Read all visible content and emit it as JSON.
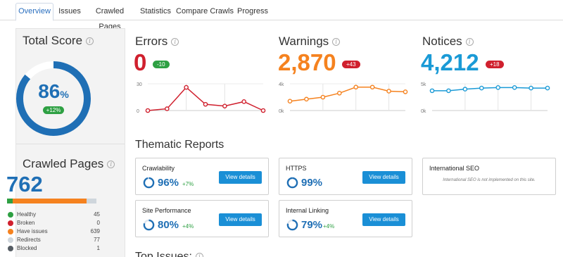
{
  "tabs": [
    "Overview",
    "Issues",
    "Crawled Pages",
    "Statistics",
    "Compare Crawls",
    "Progress"
  ],
  "total_score": {
    "title": "Total Score",
    "value": "86",
    "unit": "%",
    "delta": "+12%",
    "fraction": 0.86
  },
  "crawled_pages": {
    "title": "Crawled Pages",
    "value": "762",
    "legend": [
      {
        "label": "Healthy",
        "count": "45",
        "color": "#2ea043"
      },
      {
        "label": "Broken",
        "count": "0",
        "color": "#d0202e"
      },
      {
        "label": "Have issues",
        "count": "639",
        "color": "#f5821f"
      },
      {
        "label": "Redirects",
        "count": "77",
        "color": "#cfd6dc"
      },
      {
        "label": "Blocked",
        "count": "1",
        "color": "#555c63"
      }
    ]
  },
  "metrics": {
    "errors": {
      "title": "Errors",
      "value": "0",
      "delta": "-10",
      "color": "#d0202e",
      "badge_color": "#2ea043"
    },
    "warnings": {
      "title": "Warnings",
      "value": "2,870",
      "delta": "+43",
      "color": "#f5821f",
      "badge_color": "#d0202e"
    },
    "notices": {
      "title": "Notices",
      "value": "4,212",
      "delta": "+18",
      "color": "#1a9ad6",
      "badge_color": "#d0202e"
    }
  },
  "chart_data": [
    {
      "type": "line",
      "series": [
        {
          "values": [
            0,
            2,
            26,
            7,
            5,
            10,
            0
          ]
        }
      ],
      "ylim": [
        0,
        30
      ],
      "ytick_labels": [
        "30",
        "0"
      ],
      "grid": true
    },
    {
      "type": "line",
      "series": [
        {
          "values": [
            1.4,
            1.7,
            2.0,
            2.6,
            3.5,
            3.5,
            2.9,
            2.8
          ]
        }
      ],
      "ylim": [
        0,
        4
      ],
      "ytick_labels": [
        "4k",
        "0k"
      ],
      "grid": true
    },
    {
      "type": "line",
      "series": [
        {
          "values": [
            3.7,
            3.7,
            4.0,
            4.2,
            4.3,
            4.3,
            4.2,
            4.2
          ]
        }
      ],
      "ylim": [
        0,
        5
      ],
      "ytick_labels": [
        "5k",
        "0k"
      ],
      "grid": true
    }
  ],
  "thematic": {
    "title": "Thematic Reports",
    "view_label": "View details",
    "cards": [
      {
        "title": "Crawlability",
        "pct": "96%",
        "delta": "+7%",
        "fraction": 0.96
      },
      {
        "title": "HTTPS",
        "pct": "99%",
        "delta": "",
        "fraction": 0.99
      },
      {
        "title": "International SEO",
        "note": "International SEO is not implemented on this site."
      },
      {
        "title": "Site Performance",
        "pct": "80%",
        "delta": "+4%",
        "fraction": 0.8
      },
      {
        "title": "Internal Linking",
        "pct": "79%",
        "delta": "+4%",
        "fraction": 0.79
      }
    ]
  },
  "top_issues": {
    "title": "Top Issues:"
  }
}
